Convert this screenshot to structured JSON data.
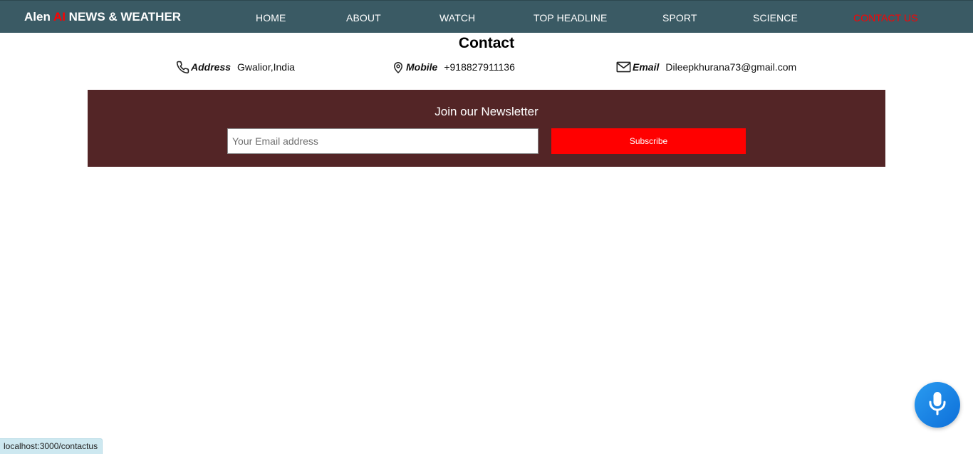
{
  "brand": {
    "prefix": "Alen ",
    "highlight": "AI",
    "suffix": " NEWS & WEATHER"
  },
  "nav": {
    "home": "HOME",
    "about": "ABOUT",
    "watch": "WATCH",
    "top_headline": "TOP HEADLINE",
    "sport": "SPORT",
    "science": "SCIENCE",
    "contact_us": "CONTACT US"
  },
  "contact": {
    "title": "Contact",
    "address": {
      "label": "Address",
      "value": "Gwalior,India",
      "icon": "phone-icon"
    },
    "mobile": {
      "label": "Mobile",
      "value": "+918827911136",
      "icon": "location-pin-icon"
    },
    "email": {
      "label": "Email",
      "value": "Dileepkhurana73@gmail.com",
      "icon": "mail-icon"
    }
  },
  "newsletter": {
    "title": "Join our Newsletter",
    "email_placeholder": "Your Email address",
    "email_value": "",
    "subscribe_label": "Subscribe"
  },
  "voice_assistant": {
    "icon": "microphone-icon"
  },
  "status_bar": {
    "url": "localhost:3000/contactus"
  },
  "colors": {
    "navbar": "#3a5a64",
    "accent_red": "#ff0000",
    "newsletter_bg": "#532526",
    "mic_blue": "#1581e6"
  }
}
